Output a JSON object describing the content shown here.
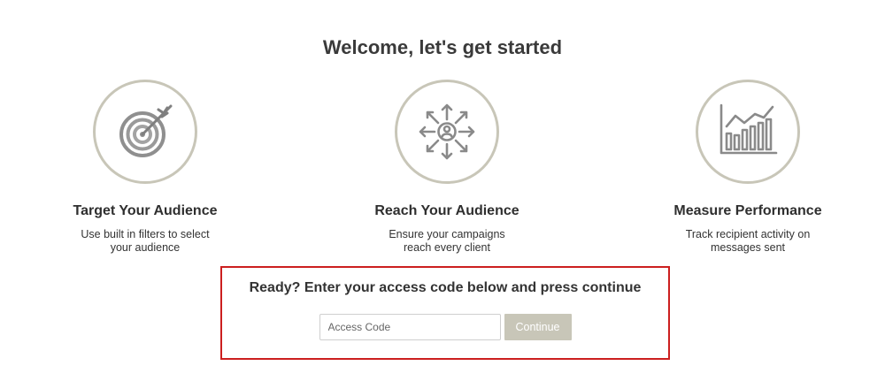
{
  "page": {
    "title": "Welcome, let's get started"
  },
  "features": [
    {
      "icon": "target-icon",
      "title": "Target Your Audience",
      "description": "Use built in filters to select your audience"
    },
    {
      "icon": "reach-audience-icon",
      "title": "Reach Your Audience",
      "description": "Ensure your campaigns reach every client"
    },
    {
      "icon": "performance-chart-icon",
      "title": "Measure Performance",
      "description": "Track recipient activity on messages sent"
    }
  ],
  "access": {
    "heading": "Ready? Enter your access code below and press continue",
    "input_value": "",
    "input_placeholder": "Access Code",
    "continue_label": "Continue"
  },
  "colors": {
    "circle_border": "#c8c6b8",
    "icon_gray": "#8a8a8a",
    "highlight_border": "#cc1f1f",
    "button_bg": "#c8c6b8"
  }
}
